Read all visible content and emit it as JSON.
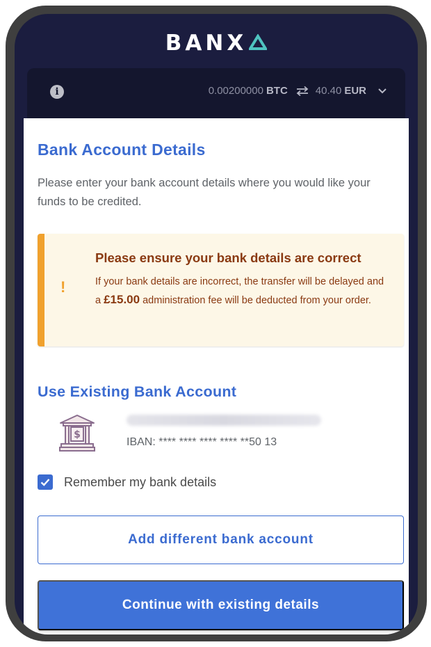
{
  "brand": {
    "name": "BANX"
  },
  "rate": {
    "crypto_amount": "0.00200000",
    "crypto_currency": "BTC",
    "fiat_amount": "40.40",
    "fiat_currency": "EUR"
  },
  "page": {
    "title": "Bank Account Details",
    "subtitle": "Please enter your bank account details where you would like your funds to be credited."
  },
  "warning": {
    "icon": "!",
    "title": "Please ensure your bank details are correct",
    "text_before": "If your bank details are incorrect, the transfer will be delayed and a ",
    "fee": "£15.00",
    "text_after": " administration fee will be deducted from your order."
  },
  "existing": {
    "title": "Use Existing Bank Account",
    "iban": "IBAN: **** **** **** **** **50 13"
  },
  "remember": {
    "label": "Remember my bank details",
    "checked": true
  },
  "buttons": {
    "add_label": "Add different bank account",
    "continue_label": "Continue with existing details"
  },
  "colors": {
    "accent": "#3b6bd0",
    "warning_border": "#f0a12e",
    "warning_text": "#8a3a12",
    "header_bg": "#1b1d3f",
    "brand_triangle": "#4fc3c0"
  }
}
